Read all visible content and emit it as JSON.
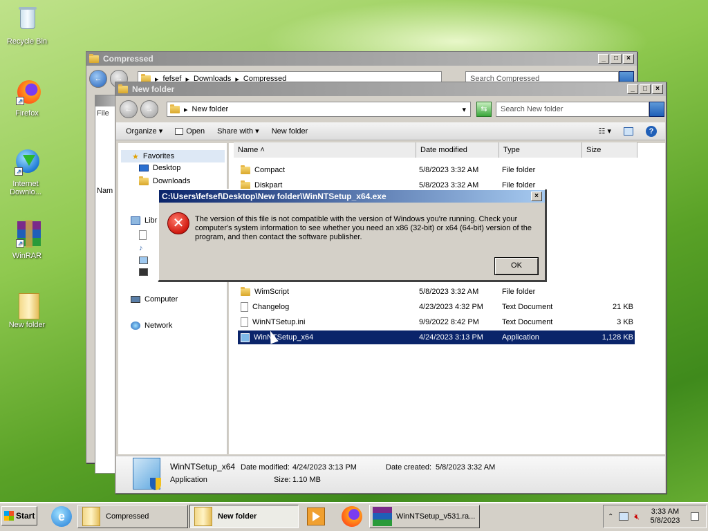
{
  "desktop": {
    "icons": [
      {
        "label": "Recycle Bin",
        "icon": "recycle-bin-icon"
      },
      {
        "label": "Firefox",
        "icon": "firefox-icon"
      },
      {
        "label": "Internet Downlo...",
        "icon": "internet-download-manager-icon"
      },
      {
        "label": "WinRAR",
        "icon": "winrar-icon"
      },
      {
        "label": "New folder",
        "icon": "folder-icon"
      }
    ]
  },
  "back_window": {
    "title": "Compressed",
    "address": [
      "fefsef",
      "Downloads",
      "Compressed"
    ],
    "search_placeholder": "Search Compressed",
    "menu_file": "File",
    "col_name": "Nam"
  },
  "front_window": {
    "title": "New folder",
    "address": "New folder",
    "search_placeholder": "Search New folder",
    "toolbar": {
      "organize": "Organize",
      "open": "Open",
      "share": "Share with",
      "new_folder": "New folder"
    },
    "nav": {
      "favorites": "Favorites",
      "desktop": "Desktop",
      "downloads": "Downloads",
      "libraries": "Libr",
      "computer": "Computer",
      "network": "Network"
    },
    "columns": {
      "name": "Name",
      "date": "Date modified",
      "type": "Type",
      "size": "Size"
    },
    "files": [
      {
        "name": "Compact",
        "date": "5/8/2023 3:32 AM",
        "type": "File folder",
        "size": "",
        "kind": "folder"
      },
      {
        "name": "Diskpart",
        "date": "5/8/2023 3:32 AM",
        "type": "File folder",
        "size": "",
        "kind": "folder"
      },
      {
        "name": "WimScript",
        "date": "5/8/2023 3:32 AM",
        "type": "File folder",
        "size": "",
        "kind": "folder"
      },
      {
        "name": "Changelog",
        "date": "4/23/2023 4:32 PM",
        "type": "Text Document",
        "size": "21 KB",
        "kind": "doc"
      },
      {
        "name": "WinNTSetup.ini",
        "date": "9/9/2022 8:42 PM",
        "type": "Text Document",
        "size": "3 KB",
        "kind": "doc"
      },
      {
        "name": "WinNTSetup_x64",
        "date": "4/24/2023 3:13 PM",
        "type": "Application",
        "size": "1,128 KB",
        "kind": "app"
      }
    ],
    "details": {
      "name": "WinNTSetup_x64",
      "modified_label": "Date modified:",
      "modified": "4/24/2023 3:13 PM",
      "created_label": "Date created:",
      "created": "5/8/2023 3:32 AM",
      "type": "Application",
      "size_label": "Size:",
      "size": "1.10 MB"
    }
  },
  "dialog": {
    "title": "C:\\Users\\fefsef\\Desktop\\New folder\\WinNTSetup_x64.exe",
    "message": "The version of this file is not compatible with the version of Windows you're running. Check your computer's system information to see whether you need an x86 (32-bit) or x64 (64-bit) version of the program, and then contact the software publisher.",
    "ok": "OK"
  },
  "taskbar": {
    "start": "Start",
    "items": [
      "Compressed",
      "New folder",
      "WinNTSetup_v531.ra..."
    ],
    "time": "3:33 AM",
    "date": "5/8/2023"
  }
}
